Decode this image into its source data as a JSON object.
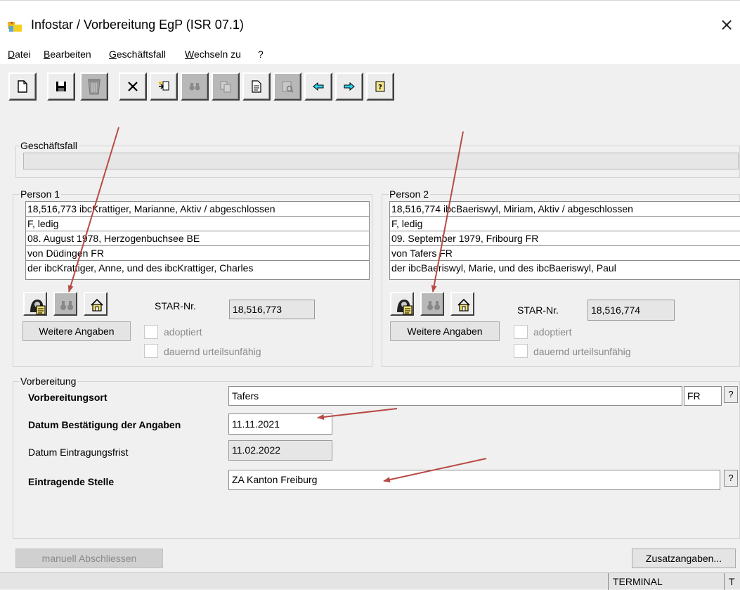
{
  "window": {
    "title": "Infostar / Vorbereitung EgP (ISR 07.1)",
    "close_glyph": "×"
  },
  "menu": {
    "items": [
      {
        "label": "Datei"
      },
      {
        "label": "Bearbeiten"
      },
      {
        "label": "Geschäftsfall"
      },
      {
        "label": "Wechseln zu"
      },
      {
        "label": "?"
      }
    ]
  },
  "toolbar": {
    "buttons": [
      {
        "icon": "new-document-icon",
        "enabled": true
      },
      {
        "icon": "save-disk-icon",
        "enabled": true
      },
      {
        "icon": "trash-icon",
        "enabled": false
      },
      {
        "icon": "close-x-icon",
        "enabled": true
      },
      {
        "icon": "import-icon",
        "enabled": true
      },
      {
        "icon": "binoculars-icon",
        "enabled": false
      },
      {
        "icon": "copy-icon",
        "enabled": false
      },
      {
        "icon": "document-icon",
        "enabled": true
      },
      {
        "icon": "preview-icon",
        "enabled": false
      },
      {
        "icon": "arrow-left-icon",
        "enabled": true
      },
      {
        "icon": "arrow-right-icon",
        "enabled": true
      },
      {
        "icon": "help-icon",
        "enabled": true
      }
    ]
  },
  "geschaeftsfall": {
    "label": "Geschäftsfall",
    "value": ""
  },
  "person1": {
    "label": "Person 1",
    "lines": [
      "18,516,773  ibcKrattiger, Marianne, Aktiv / abgeschlossen",
      "F, ledig",
      "08. August 1978, Herzogenbuchsee BE",
      "von Düdingen FR",
      "der ibcKrattiger, Anne, und des ibcKrattiger, Charles"
    ],
    "star_label": "STAR-Nr.",
    "star_value": "18,516,773",
    "weitere_label": "Weitere Angaben",
    "adoptiert_label": "adoptiert",
    "adoptiert_checked": false,
    "dauernd_label": "dauernd urteilsunfähig",
    "dauernd_checked": false
  },
  "person2": {
    "label": "Person 2",
    "lines": [
      "18,516,774  ibcBaeriswyl, Miriam, Aktiv / abgeschlossen",
      "F, ledig",
      "09. September 1979, Fribourg FR",
      "von Tafers FR",
      "der ibcBaeriswyl, Marie, und des ibcBaeriswyl, Paul"
    ],
    "star_label": "STAR-Nr.",
    "star_value": "18,516,774",
    "weitere_label": "Weitere Angaben",
    "adoptiert_label": "adoptiert",
    "adoptiert_checked": false,
    "dauernd_label": "dauernd urteilsunfähig",
    "dauernd_checked": false
  },
  "vorbereitung": {
    "label": "Vorbereitung",
    "ort_label": "Vorbereitungsort",
    "ort_value": "Tafers",
    "kanton_value": "FR",
    "help_label": "?",
    "datum_label": "Datum Bestätigung der Angaben",
    "datum_value": "11.11.2021",
    "frist_label": "Datum Eintragungsfrist",
    "frist_value": "11.02.2022",
    "stelle_label": "Eintragende Stelle",
    "stelle_value": "ZA Kanton Freiburg"
  },
  "footer": {
    "abschliessen_label": "manuell Abschliessen",
    "zusatz_label": "Zusatzangaben..."
  },
  "status": {
    "terminal": "TERMINAL",
    "t": "T"
  },
  "colors": {
    "annotation_arrow": "#b84a44",
    "window_bg": "#f0f0f0",
    "readonly_bg": "#e6e6e6"
  }
}
